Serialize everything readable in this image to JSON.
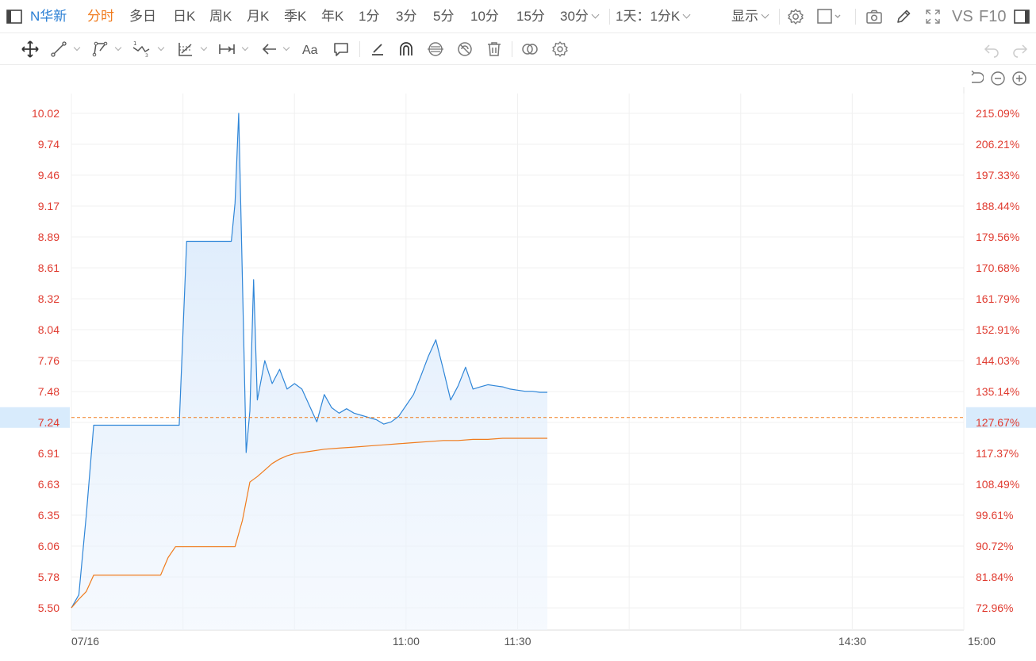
{
  "toolbar": {
    "symbol": "N华新",
    "periods": [
      "分时",
      "多日",
      "日K",
      "周K",
      "月K",
      "季K",
      "年K",
      "1分",
      "3分",
      "5分",
      "10分",
      "15分",
      "30分"
    ],
    "active_period": "分时",
    "range_select": "1天：1分K",
    "display_select": "显示",
    "vs_label": "VS",
    "f10_label": "F10"
  },
  "drawing_tools": [
    "move-icon",
    "segment-icon",
    "polyline-icon",
    "wave-icon",
    "fibonacci-icon",
    "measure-icon",
    "arrow-icon",
    "text-icon",
    "comment-icon",
    "pen-icon",
    "magnet-icon",
    "lock-icon",
    "hide-icon",
    "delete-icon",
    "compare-icon",
    "settings-icon"
  ],
  "colors": {
    "price_line": "#2f86d8",
    "price_fill_top": "#d4e6fb",
    "avg_line": "#f07b1d",
    "axis_text": "#e03c31",
    "current_marker_bg": "#d8ebfc",
    "active_tab": "#f07b1d"
  },
  "chart_data": {
    "type": "line",
    "date": "07/16",
    "x_ticks": [
      "07/16",
      "11:00",
      "11:30",
      "14:30",
      "15:00"
    ],
    "y_ticks_left": [
      "10.02",
      "9.74",
      "9.46",
      "9.17",
      "8.89",
      "8.61",
      "8.32",
      "8.04",
      "7.76",
      "7.48",
      "7.24",
      "6.91",
      "6.63",
      "6.35",
      "6.06",
      "5.78",
      "5.50"
    ],
    "y_ticks_right": [
      "215.09%",
      "206.21%",
      "197.33%",
      "188.44%",
      "179.56%",
      "170.68%",
      "161.79%",
      "152.91%",
      "144.03%",
      "135.14%",
      "127.67%",
      "117.37%",
      "108.49%",
      "99.61%",
      "90.72%",
      "81.84%",
      "72.96%"
    ],
    "ylim": [
      5.5,
      10.02
    ],
    "current_price": "7.24",
    "current_change": "127.67%",
    "session_minutes": 240,
    "series": [
      {
        "key": "price",
        "minutes": [
          0,
          2,
          4,
          6,
          8,
          10,
          12,
          14,
          16,
          18,
          20,
          22,
          24,
          26,
          28,
          29,
          31,
          33,
          35,
          36,
          37,
          38,
          39,
          40,
          41,
          42,
          43,
          44,
          45,
          46,
          47,
          48,
          49,
          50,
          52,
          54,
          56,
          58,
          60,
          62,
          64,
          66,
          68,
          70,
          72,
          74,
          76,
          78,
          80,
          82,
          84,
          86,
          88,
          90,
          92,
          94,
          96,
          98,
          100,
          102,
          104,
          106,
          108,
          110,
          112,
          114,
          116,
          118,
          120,
          122,
          124,
          126,
          128,
          130,
          132,
          134,
          136,
          138,
          140,
          142,
          144,
          146,
          148,
          150,
          152,
          154,
          156,
          158,
          160,
          162,
          164,
          166,
          168,
          170,
          172,
          174,
          176,
          178,
          180,
          182,
          184,
          186,
          188,
          190,
          192,
          194,
          196,
          198,
          200,
          202,
          204,
          206,
          208,
          210,
          212,
          214,
          216,
          218,
          220,
          222,
          224,
          226,
          228,
          230,
          232,
          234,
          236,
          238,
          240
        ],
        "values": [
          5.5,
          5.62,
          6.35,
          7.17,
          7.17,
          7.17,
          7.17,
          7.17,
          7.17,
          7.17,
          7.17,
          7.17,
          7.17,
          7.17,
          7.17,
          7.17,
          8.85,
          8.85,
          8.85,
          8.85,
          8.85,
          8.85,
          8.85,
          8.85,
          8.85,
          8.85,
          8.85,
          9.2,
          10.02,
          8.5,
          6.92,
          7.3,
          8.5,
          7.4,
          7.76,
          7.55,
          7.68,
          7.5,
          7.55,
          7.5,
          7.35,
          7.2,
          7.45,
          7.33,
          7.28,
          7.32,
          7.28,
          7.26,
          7.24,
          7.22,
          7.18,
          7.2,
          7.25,
          7.35,
          7.45,
          7.62,
          7.8,
          7.95,
          7.68,
          7.4,
          7.53,
          7.7,
          7.5,
          7.52,
          7.54,
          7.53,
          7.52,
          7.5,
          7.49,
          7.48,
          7.48,
          7.47,
          7.47,
          7.46,
          7.46,
          7.47,
          7.46,
          7.46,
          7.46,
          7.45,
          7.44,
          7.43,
          7.42,
          7.39,
          7.36,
          7.31,
          7.3,
          7.35,
          7.43,
          7.41,
          7.38,
          7.37,
          7.36,
          7.36,
          7.35,
          7.34,
          7.34,
          7.33,
          7.33,
          7.32,
          7.32,
          7.3,
          7.28,
          7.26,
          7.25,
          7.25,
          7.24,
          7.24,
          7.24,
          7.24,
          7.24,
          7.24,
          7.24,
          7.24,
          7.24,
          7.24,
          7.24,
          7.24,
          7.24,
          7.24,
          7.24,
          7.24,
          7.24,
          7.24,
          7.24,
          7.24,
          7.24,
          7.24,
          7.24,
          7.24
        ],
        "end_minute": 128
      },
      {
        "key": "average",
        "minutes": [
          0,
          2,
          4,
          6,
          8,
          10,
          12,
          14,
          16,
          18,
          20,
          22,
          24,
          26,
          28,
          30,
          32,
          34,
          36,
          38,
          40,
          42,
          44,
          46,
          48,
          50,
          52,
          54,
          56,
          58,
          60,
          64,
          68,
          72,
          76,
          80,
          84,
          88,
          92,
          96,
          100,
          104,
          108,
          112,
          116,
          120,
          124,
          128
        ],
        "values": [
          5.5,
          5.58,
          5.65,
          5.8,
          5.8,
          5.8,
          5.8,
          5.8,
          5.8,
          5.8,
          5.8,
          5.8,
          5.8,
          5.96,
          6.06,
          6.06,
          6.06,
          6.06,
          6.06,
          6.06,
          6.06,
          6.06,
          6.06,
          6.3,
          6.65,
          6.7,
          6.76,
          6.82,
          6.86,
          6.89,
          6.91,
          6.93,
          6.95,
          6.96,
          6.97,
          6.98,
          6.99,
          7.0,
          7.01,
          7.02,
          7.03,
          7.03,
          7.04,
          7.04,
          7.05,
          7.05,
          7.05,
          7.05
        ]
      }
    ],
    "grid": true
  }
}
